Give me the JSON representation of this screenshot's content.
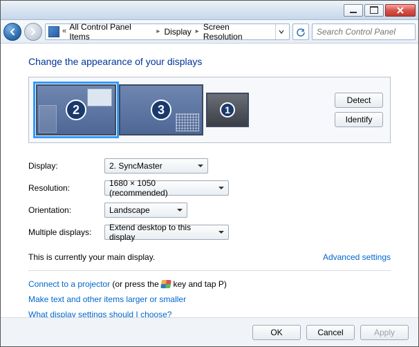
{
  "titlebar": {},
  "nav": {
    "breadcrumb": {
      "prefix": "«",
      "item1": "All Control Panel Items",
      "item2": "Display",
      "item3": "Screen Resolution"
    },
    "search_placeholder": "Search Control Panel"
  },
  "main": {
    "heading": "Change the appearance of your displays",
    "detect_label": "Detect",
    "identify_label": "Identify",
    "display_label": "Display:",
    "display_value": "2. SyncMaster",
    "resolution_label": "Resolution:",
    "resolution_value": "1680 × 1050 (recommended)",
    "orientation_label": "Orientation:",
    "orientation_value": "Landscape",
    "multiple_label": "Multiple displays:",
    "multiple_value": "Extend desktop to this display",
    "status_text": "This is currently your main display.",
    "advanced_link": "Advanced settings",
    "projector_link": "Connect to a projector",
    "projector_suffix_a": " (or press the ",
    "projector_suffix_b": " key and tap P)",
    "textsize_link": "Make text and other items larger or smaller",
    "whatsettings_link": "What display settings should I choose?",
    "monitors": {
      "one": "1",
      "two": "2",
      "three": "3"
    }
  },
  "footer": {
    "ok": "OK",
    "cancel": "Cancel",
    "apply": "Apply"
  }
}
